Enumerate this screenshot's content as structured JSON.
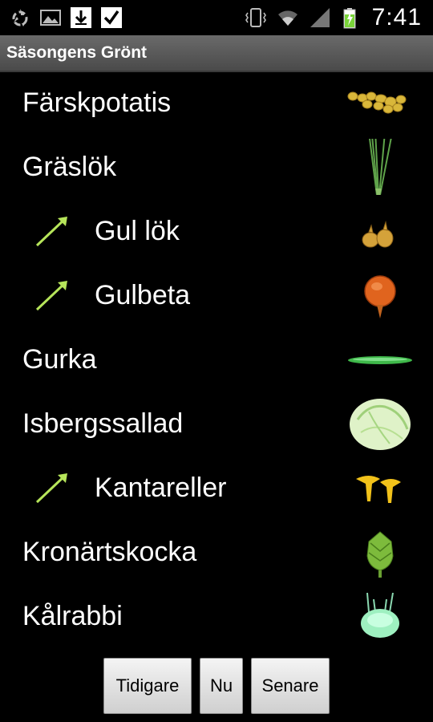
{
  "status_bar": {
    "time": "7:41",
    "icons": [
      "recycle-icon",
      "gallery-icon",
      "download-icon",
      "check-icon",
      "vibrate-icon",
      "wifi-icon",
      "signal-icon",
      "battery-charging-icon"
    ]
  },
  "app": {
    "title": "Säsongens Grönt"
  },
  "items": [
    {
      "label": "Färskpotatis",
      "trend": false,
      "image": "new-potatoes-image"
    },
    {
      "label": "Gräslök",
      "trend": false,
      "image": "chives-image"
    },
    {
      "label": "Gul lök",
      "trend": true,
      "image": "yellow-onion-image"
    },
    {
      "label": "Gulbeta",
      "trend": true,
      "image": "yellow-beet-image"
    },
    {
      "label": "Gurka",
      "trend": false,
      "image": "cucumber-image"
    },
    {
      "label": "Isbergssallad",
      "trend": false,
      "image": "iceberg-lettuce-image"
    },
    {
      "label": "Kantareller",
      "trend": true,
      "image": "chanterelles-image"
    },
    {
      "label": "Kronärtskocka",
      "trend": false,
      "image": "artichoke-image"
    },
    {
      "label": "Kålrabbi",
      "trend": false,
      "image": "kohlrabi-image"
    }
  ],
  "buttons": {
    "earlier": "Tidigare",
    "now": "Nu",
    "later": "Senare"
  },
  "colors": {
    "background": "#000000",
    "titlebar": "#5a5a5a",
    "trend_arrow": "#b6e55a"
  }
}
